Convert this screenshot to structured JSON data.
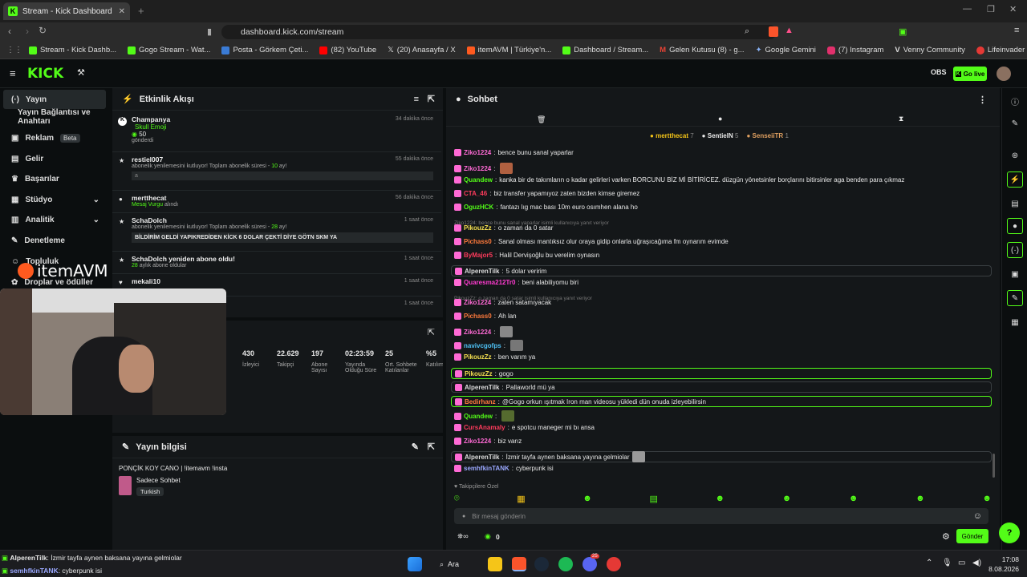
{
  "browser": {
    "tab_title": "Stream - Kick Dashboard",
    "url": "dashboard.kick.com/stream",
    "bookmarks": [
      {
        "label": "Stream - Kick Dashb...",
        "color": "#53fc18"
      },
      {
        "label": "Gogo Stream - Wat...",
        "color": "#53fc18"
      },
      {
        "label": "Posta - Görkem Çeti...",
        "color": "#3a7bd5"
      },
      {
        "label": "(82) YouTube",
        "color": "#ff0000"
      },
      {
        "label": "(20) Anasayfa / X",
        "color": "#ffffff"
      },
      {
        "label": "itemAVM | Türkiye'n...",
        "color": "#ff5a1f"
      },
      {
        "label": "Dashboard / Stream...",
        "color": "#53fc18"
      },
      {
        "label": "Gelen Kutusu (8) - g...",
        "color": "#ea4335"
      },
      {
        "label": "Google Gemini",
        "color": "#8ab4f8"
      },
      {
        "label": "(7) Instagram",
        "color": "#e1306c"
      },
      {
        "label": "Venny Community",
        "color": "#dddddd"
      },
      {
        "label": "Lifeinvader - VennyV",
        "color": "#e53935"
      }
    ]
  },
  "header": {
    "logo": "KICK",
    "go_live": "Go live"
  },
  "sidebar": {
    "items": [
      {
        "label": "Yayın",
        "active": true
      },
      {
        "label": "Yayın Bağlantısı ve Anahtarı"
      },
      {
        "label": "Reklam",
        "badge": "Beta"
      },
      {
        "label": "Gelir"
      },
      {
        "label": "Başarılar"
      },
      {
        "label": "Stüdyo"
      },
      {
        "label": "Analitik"
      },
      {
        "label": "Denetleme"
      },
      {
        "label": "Topluluk"
      },
      {
        "label": "Droplar ve ödüller"
      }
    ]
  },
  "overlay": {
    "brand": "itemAVM"
  },
  "activity": {
    "title": "Etkinlik Akışı",
    "items": [
      {
        "name": "Champanya",
        "line1": "Skull Emoji",
        "line2": "50",
        "line3": "gönderdi",
        "time": "34 dakika önce"
      },
      {
        "name": "restiel007",
        "line1": "abonelik yenilemesini kutluyor! Toplam abonelik süresi - ",
        "months": "10",
        "suffix": " ay!",
        "note": "a",
        "time": "55 dakika önce"
      },
      {
        "name": "mertthecat",
        "line1": "Mesaj Vurgu",
        "suffix": " alındı",
        "time": "56 dakika önce"
      },
      {
        "name": "SchaDolch",
        "line1": "abonelik yenilemesini kutluyor! Toplam abonelik süresi - ",
        "months": "28",
        "suffix": " ay!",
        "note": "BİLDİRİM GELDİ YAPIKREDİDEN KİCK 6 DOLAR ÇEKTİ DİYE GÖTN SKM YA",
        "time": "1 saat önce"
      },
      {
        "name": "SchaDolch yeniden abone oldu!",
        "months": "28",
        "suffix": " aylık abone oldular",
        "time": "1 saat önce"
      },
      {
        "name": "mekali10",
        "time": "1 saat önce"
      },
      {
        "name": "",
        "time": "1 saat önce"
      }
    ]
  },
  "stats": {
    "cells": [
      {
        "value": "430",
        "label": "İzleyici"
      },
      {
        "value": "22.629",
        "label": "Takipçi"
      },
      {
        "value": "197",
        "label": "Abone Sayısı"
      },
      {
        "value": "02:23:59",
        "label": "Yayında Olduğu Süre"
      },
      {
        "value": "25",
        "label": "Ort. Sohbete Katılanlar"
      },
      {
        "value": "%5",
        "label": "Katılım"
      }
    ]
  },
  "stream_info": {
    "title": "Yayın bilgisi",
    "stream_title": "PONÇİK KOY CANO | !itemavm !insta",
    "category": "Sadece Sohbet",
    "tag": "Turkish"
  },
  "chat": {
    "title": "Sohbet",
    "top_users": [
      {
        "name": "mertthecat",
        "count": "7",
        "color": "#f5c518"
      },
      {
        "name": "SentieIN",
        "count": "5",
        "color": "#dddddd"
      },
      {
        "name": "SenseiiTR",
        "count": "1",
        "color": "#e0a060"
      }
    ],
    "messages": [
      {
        "user": "Ziko1224",
        "color": "#ff6ad5",
        "text": "bence bunu sanal yaparlar"
      },
      {
        "user": "Ziko1224",
        "color": "#ff6ad5",
        "text": "",
        "emote": "#b06040"
      },
      {
        "user": "Quandew",
        "color": "#53fc18",
        "text": "kanka bir de takımların o kadar gelirleri varken BORCUNU BİZ Mİ BİTİRİCEZ. düzgün yönetsinler borçlarını bitirsinler aga benden para çıkmaz"
      },
      {
        "user": "CTA_46",
        "color": "#ff3b5c",
        "text": "biz transfer yapamıyoz zaten bizden kimse giremez"
      },
      {
        "user": "OguzHCK",
        "color": "#53fc18",
        "text": "fantazı lıg mac bası 10m euro osımhen alana ho"
      },
      {
        "reply": "Ziko1224: bence bunu sanal yaparlar isimli kullanıcıya yanıt veriyor"
      },
      {
        "user": "PikouzZz",
        "color": "#f5e050",
        "text": "o zaman da 0 satar"
      },
      {
        "user": "Pichass0",
        "color": "#ff7a3c",
        "text": "Sanal olması mantıksız olur oraya gidip onlarla uğraşıcağıma fm oynarım evimde"
      },
      {
        "user": "ByMajor5",
        "color": "#ff3b5c",
        "text": "Halil Dervişoğlu bu verelim oynasın"
      },
      {
        "user": "AlperenTilk",
        "color": "#dddddd",
        "text": "5 dolar veririm",
        "box": "hl2"
      },
      {
        "user": "Quaresma212Tr0",
        "color": "#ff3bd0",
        "text": "beni alabiliyomu biri"
      },
      {
        "reply": "PikouzZz: o zaman da 0 satar isimli kullanıcıya yanıt veriyor"
      },
      {
        "user": "Ziko1224",
        "color": "#ff6ad5",
        "text": "zaten satamıyacak"
      },
      {
        "user": "Pichass0",
        "color": "#ff7a3c",
        "text": "Ah lan"
      },
      {
        "user": "Ziko1224",
        "color": "#ff6ad5",
        "text": "",
        "emote": "#888888"
      },
      {
        "user": "navivcgofps",
        "color": "#4fc3f7",
        "text": "",
        "emote": "#777777"
      },
      {
        "user": "PikouzZz",
        "color": "#f5e050",
        "text": "ben varım ya"
      },
      {
        "user": "PikouzZz",
        "color": "#f5e050",
        "text": "gogo",
        "box": "hl"
      },
      {
        "user": "AlperenTilk",
        "color": "#dddddd",
        "text": "Pallaworld mü ya",
        "box": "hl2"
      },
      {
        "user": "Bedirhanz",
        "color": "#ff7a3c",
        "text": "@Gogo orkun ışıtmak Iron man videosu yükledi dün onuda izleyebilirsin",
        "box": "hl"
      },
      {
        "user": "Quandew",
        "color": "#53fc18",
        "text": "",
        "emote": "#556b2f"
      },
      {
        "user": "CursAnamaly",
        "color": "#ff3b5c",
        "text": "e spotcu maneger mi bı ansa"
      },
      {
        "user": "Ziko1224",
        "color": "#ff6ad5",
        "text": "biz varız"
      },
      {
        "user": "AlperenTilk",
        "color": "#dddddd",
        "text": "İzmir tayfa aynen baksana yayına gelmiolar",
        "box": "hl2",
        "emote_after": "#999999"
      },
      {
        "user": "semhfkinTANK",
        "color": "#9aa8ff",
        "text": "cyberpunk isi"
      }
    ],
    "followers_label": "Takipçilere Özel",
    "input_placeholder": "Bir mesaj gönderin",
    "points": "0",
    "send_label": "Gönder"
  },
  "tray": {
    "msg1_user": "AlperenTilk",
    "msg1_text": ": İzmir tayfa aynen baksana yayına gelmiolar",
    "msg2_user": "semhfkinTANK",
    "msg2_text": ": cyberpunk isi"
  },
  "taskbar": {
    "search": "Ara",
    "time": "17:08",
    "date": "8.08.2026",
    "discord_badge": "25"
  }
}
